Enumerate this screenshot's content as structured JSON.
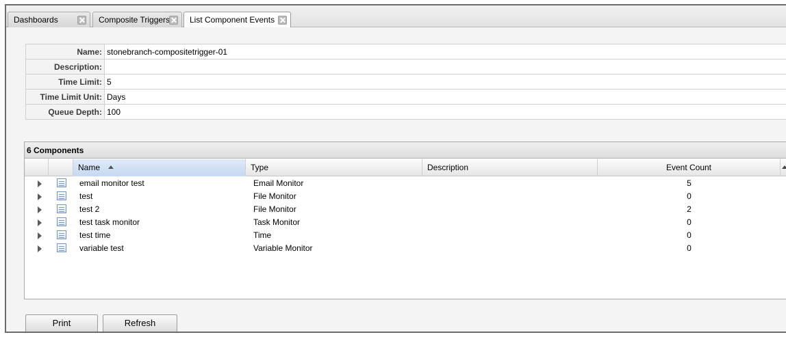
{
  "tabs": [
    {
      "label": "Dashboards",
      "active": false
    },
    {
      "label": "Composite Triggers",
      "active": false
    },
    {
      "label": "List Component Events",
      "active": true
    }
  ],
  "details": {
    "name_label": "Name:",
    "name_value": "stonebranch-compositetrigger-01",
    "description_label": "Description:",
    "description_value": "",
    "time_limit_label": "Time Limit:",
    "time_limit_value": "5",
    "time_limit_unit_label": "Time Limit Unit:",
    "time_limit_unit_value": "Days",
    "queue_depth_label": "Queue Depth:",
    "queue_depth_value": "100"
  },
  "components": {
    "title": "6 Components",
    "columns": {
      "name": "Name",
      "type": "Type",
      "description": "Description",
      "event_count": "Event Count"
    },
    "sort": {
      "column": "Name",
      "direction": "ascending"
    },
    "rows": [
      {
        "name": "email monitor test",
        "type": "Email Monitor",
        "description": "",
        "event_count": "5"
      },
      {
        "name": "test",
        "type": "File Monitor",
        "description": "",
        "event_count": "0"
      },
      {
        "name": "test 2",
        "type": "File Monitor",
        "description": "",
        "event_count": "2"
      },
      {
        "name": "test task monitor",
        "type": "Task Monitor",
        "description": "",
        "event_count": "0"
      },
      {
        "name": "test time",
        "type": "Time",
        "description": "",
        "event_count": "0"
      },
      {
        "name": "variable test",
        "type": "Variable Monitor",
        "description": "",
        "event_count": "0"
      }
    ]
  },
  "buttons": {
    "print": "Print",
    "refresh": "Refresh"
  },
  "icons": {
    "tab_close": "close-icon",
    "row_expander": "expand-arrow-icon",
    "row_icon": "component-icon",
    "sort": "sort-ascending-icon"
  }
}
